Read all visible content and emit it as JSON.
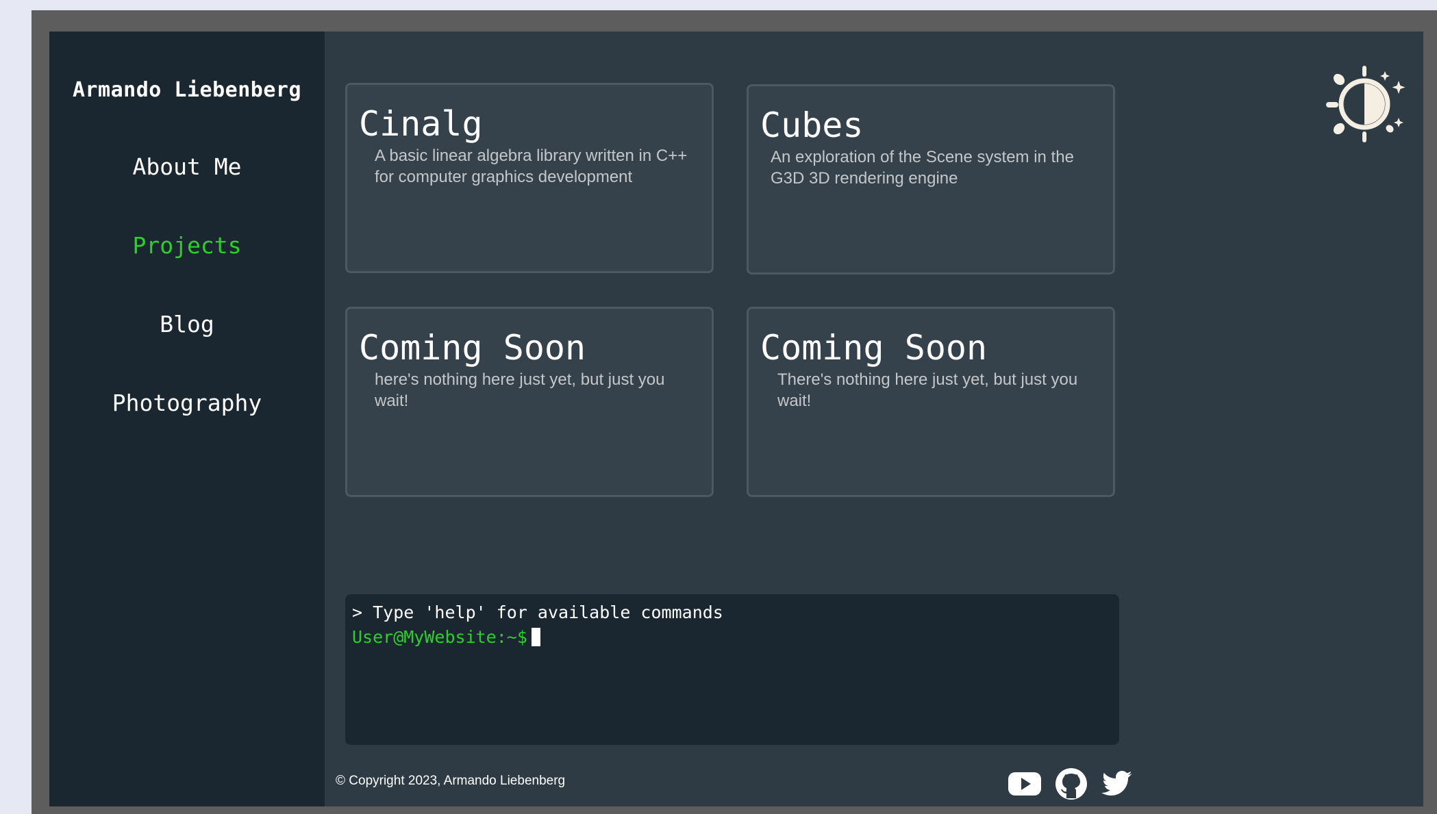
{
  "sidebar": {
    "site_title": "Armando Liebenberg",
    "nav": [
      {
        "label": "About Me",
        "active": false
      },
      {
        "label": "Projects",
        "active": true
      },
      {
        "label": "Blog",
        "active": false
      },
      {
        "label": "Photography",
        "active": false
      }
    ]
  },
  "projects": [
    {
      "title": "Cinalg",
      "description": "A basic linear algebra library written in C++ for computer graphics development"
    },
    {
      "title": "Cubes",
      "description": "An exploration of the  Scene system in the G3D 3D rendering engine"
    },
    {
      "title": "Coming Soon",
      "description": "here's nothing here just yet, but just you wait!"
    },
    {
      "title": "Coming Soon",
      "description": "There's nothing here just yet, but just you wait!"
    }
  ],
  "terminal": {
    "hint": "> Type 'help' for available commands",
    "prompt": "User@MyWebsite:~$",
    "input": ""
  },
  "footer": {
    "copyright": "© Copyright 2023, Armando Liebenberg",
    "social_icons": [
      "youtube-icon",
      "github-icon",
      "twitter-icon"
    ]
  },
  "theme_toggle_icon": "sun-moon-icon",
  "colors": {
    "accent_green": "#2ccf2c",
    "sidebar_bg": "#1b2730",
    "main_bg": "#2e3b45",
    "card_bg": "#35424b",
    "frame": "#5d5d5d"
  }
}
